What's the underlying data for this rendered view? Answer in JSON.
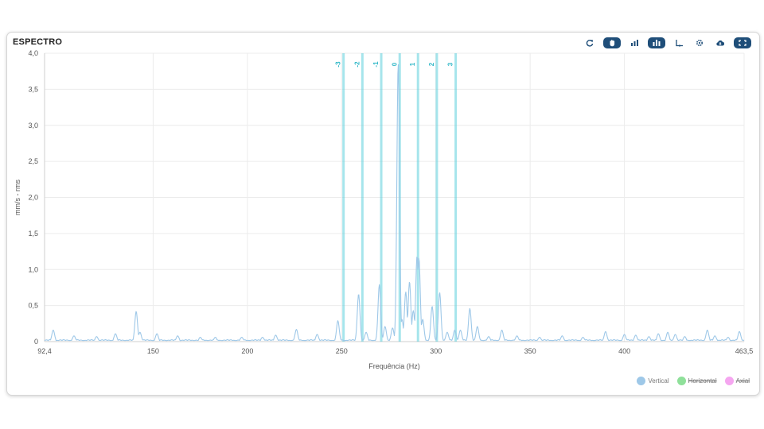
{
  "panel": {
    "title": "ESPECTRO",
    "toolbar": [
      {
        "name": "refresh-icon",
        "pill": false
      },
      {
        "name": "pan-hand-icon",
        "pill": true
      },
      {
        "name": "bar-chart-icon",
        "pill": false
      },
      {
        "name": "bar-chart-active-icon",
        "pill": true
      },
      {
        "name": "axis-cursor-icon",
        "pill": false
      },
      {
        "name": "settings-icon",
        "pill": false
      },
      {
        "name": "cloud-download-icon",
        "pill": false
      },
      {
        "name": "fullscreen-icon",
        "pill": true
      }
    ],
    "accent": "#1f4e79"
  },
  "chart_data": {
    "type": "line",
    "xlabel": "Frequência (Hz)",
    "ylabel": "mm/s - rms",
    "xlim": [
      92.4,
      463.5
    ],
    "ylim": [
      0,
      4.0
    ],
    "x_ticks": [
      92.4,
      150,
      200,
      250,
      300,
      350,
      400,
      463.5
    ],
    "x_tick_labels": [
      "92,4",
      "150",
      "200",
      "250",
      "300",
      "350",
      "400",
      "463,5"
    ],
    "y_ticks": [
      0,
      0.5,
      1.0,
      1.5,
      2.0,
      2.5,
      3.0,
      3.5,
      4.0
    ],
    "y_tick_labels": [
      "0",
      "0,5",
      "1,0",
      "1,5",
      "2,0",
      "2,5",
      "3,0",
      "3,5",
      "4,0"
    ],
    "grid": true,
    "legend_position": "bottom-right",
    "series": [
      {
        "name": "Vertical",
        "color": "#9ec8e8",
        "visible": true,
        "peaks": [
          [
            97,
            0.15
          ],
          [
            108,
            0.07
          ],
          [
            120,
            0.06
          ],
          [
            130,
            0.1
          ],
          [
            141,
            0.41
          ],
          [
            143,
            0.12
          ],
          [
            152,
            0.1
          ],
          [
            163,
            0.07
          ],
          [
            175,
            0.05
          ],
          [
            183,
            0.05
          ],
          [
            197,
            0.05
          ],
          [
            208,
            0.05
          ],
          [
            215,
            0.08
          ],
          [
            226,
            0.16
          ],
          [
            237,
            0.09
          ],
          [
            248,
            0.28
          ],
          [
            259,
            0.65
          ],
          [
            263,
            0.12
          ],
          [
            270,
            0.78
          ],
          [
            273,
            0.2
          ],
          [
            277,
            0.18
          ],
          [
            280,
            3.85
          ],
          [
            282,
            0.3
          ],
          [
            284,
            0.68
          ],
          [
            286,
            0.82
          ],
          [
            288,
            0.42
          ],
          [
            290,
            1.18
          ],
          [
            291,
            1.15
          ],
          [
            293,
            0.3
          ],
          [
            298,
            0.48
          ],
          [
            302,
            0.67
          ],
          [
            306,
            0.12
          ],
          [
            310,
            0.15
          ],
          [
            313,
            0.15
          ],
          [
            318,
            0.45
          ],
          [
            322,
            0.2
          ],
          [
            328,
            0.06
          ],
          [
            335,
            0.15
          ],
          [
            343,
            0.07
          ],
          [
            355,
            0.05
          ],
          [
            367,
            0.07
          ],
          [
            378,
            0.05
          ],
          [
            390,
            0.13
          ],
          [
            400,
            0.09
          ],
          [
            406,
            0.08
          ],
          [
            413,
            0.06
          ],
          [
            418,
            0.1
          ],
          [
            423,
            0.12
          ],
          [
            427,
            0.09
          ],
          [
            432,
            0.06
          ],
          [
            444,
            0.15
          ],
          [
            448,
            0.07
          ],
          [
            455,
            0.05
          ],
          [
            461,
            0.13
          ]
        ]
      },
      {
        "name": "Horizontal",
        "color": "#8fe09a",
        "visible": false
      },
      {
        "name": "Axial",
        "color": "#f5a6f0",
        "visible": false
      }
    ],
    "harmonic_markers": {
      "color": "#5ccfdc",
      "items": [
        {
          "label": "-3",
          "x": 251
        },
        {
          "label": "-2",
          "x": 261
        },
        {
          "label": "-1",
          "x": 271
        },
        {
          "label": "0",
          "x": 280.8
        },
        {
          "label": "1",
          "x": 290.5
        },
        {
          "label": "2",
          "x": 300.5
        },
        {
          "label": "3",
          "x": 310.5
        }
      ]
    }
  }
}
